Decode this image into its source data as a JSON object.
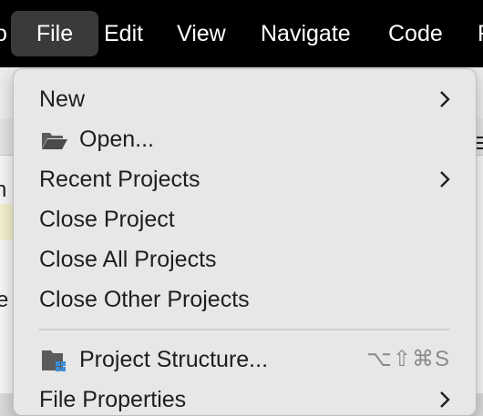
{
  "menubar": {
    "partial_left": "o",
    "items": [
      "File",
      "Edit",
      "View",
      "Navigate",
      "Code",
      "R"
    ]
  },
  "background": {
    "frag1": "n",
    "frag2": "e"
  },
  "file_menu": {
    "items": [
      {
        "label": "New",
        "submenu": true
      },
      {
        "label": "Open...",
        "icon": "folder-open-icon"
      },
      {
        "label": "Recent Projects",
        "submenu": true
      },
      {
        "label": "Close Project"
      },
      {
        "label": "Close All Projects"
      },
      {
        "label": "Close Other Projects"
      },
      {
        "label": "Project Structure...",
        "icon": "project-structure-icon",
        "shortcut": "⌥⇧⌘S"
      },
      {
        "label": "File Properties",
        "submenu": true
      }
    ]
  }
}
